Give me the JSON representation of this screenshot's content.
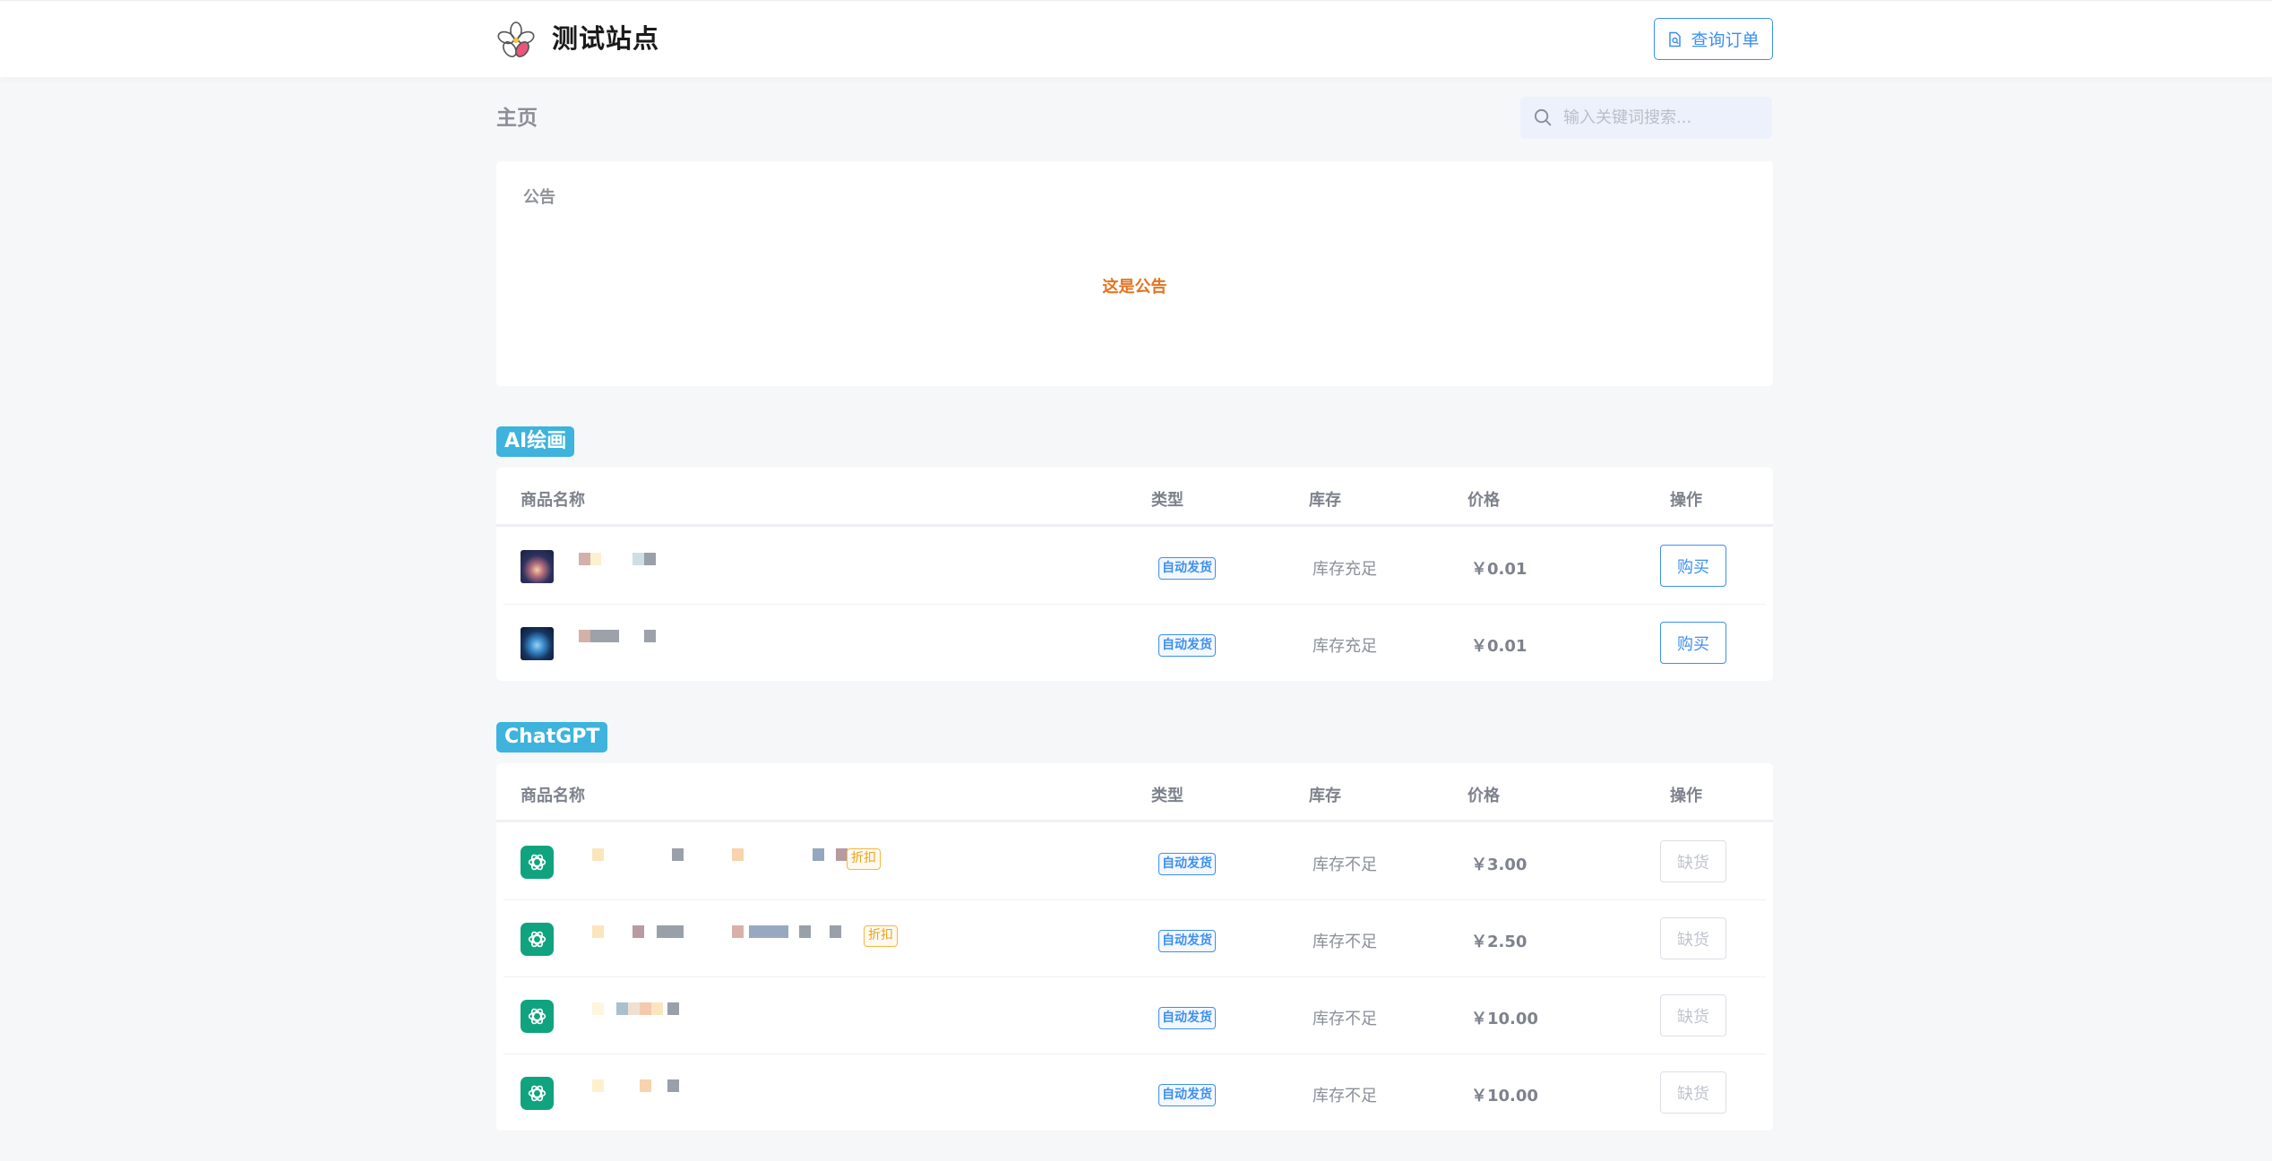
{
  "header": {
    "site_title": "测试站点",
    "order_button_label": "查询订单",
    "logo_icon": "flower-logo-icon",
    "order_icon": "document-search-icon"
  },
  "page": {
    "title": "主页",
    "search_placeholder": "输入关键词搜索..."
  },
  "notice": {
    "label": "公告",
    "text": "这是公告"
  },
  "columns": {
    "name": "商品名称",
    "type": "类型",
    "stock": "库存",
    "price": "价格",
    "action": "操作"
  },
  "sections": [
    {
      "tag": "AI绘画",
      "items": [
        {
          "thumb": "artwork-thumbnail",
          "type": "自动发货",
          "stock": "库存充足",
          "price": "￥0.01",
          "action": "购买"
        },
        {
          "thumb": "artwork-thumbnail",
          "type": "自动发货",
          "stock": "库存充足",
          "price": "￥0.01",
          "action": "购买"
        }
      ]
    },
    {
      "tag": "ChatGPT",
      "items": [
        {
          "thumb": "openai-icon",
          "discount": "折扣",
          "type": "自动发货",
          "stock": "库存不足",
          "price": "￥3.00",
          "action": "缺货"
        },
        {
          "thumb": "openai-icon",
          "discount": "折扣",
          "type": "自动发货",
          "stock": "库存不足",
          "price": "￥2.50",
          "action": "缺货"
        },
        {
          "thumb": "openai-icon",
          "type": "自动发货",
          "stock": "库存不足",
          "price": "￥10.00",
          "action": "缺货"
        },
        {
          "thumb": "openai-icon",
          "type": "自动发货",
          "stock": "库存不足",
          "price": "￥10.00",
          "action": "缺货"
        }
      ]
    }
  ],
  "colors": {
    "primary": "#3d8ff0",
    "section_tag": "#3db3dd",
    "notice_text": "#e5731e",
    "discount": "#e7a21b",
    "openai_green": "#10a37f"
  }
}
